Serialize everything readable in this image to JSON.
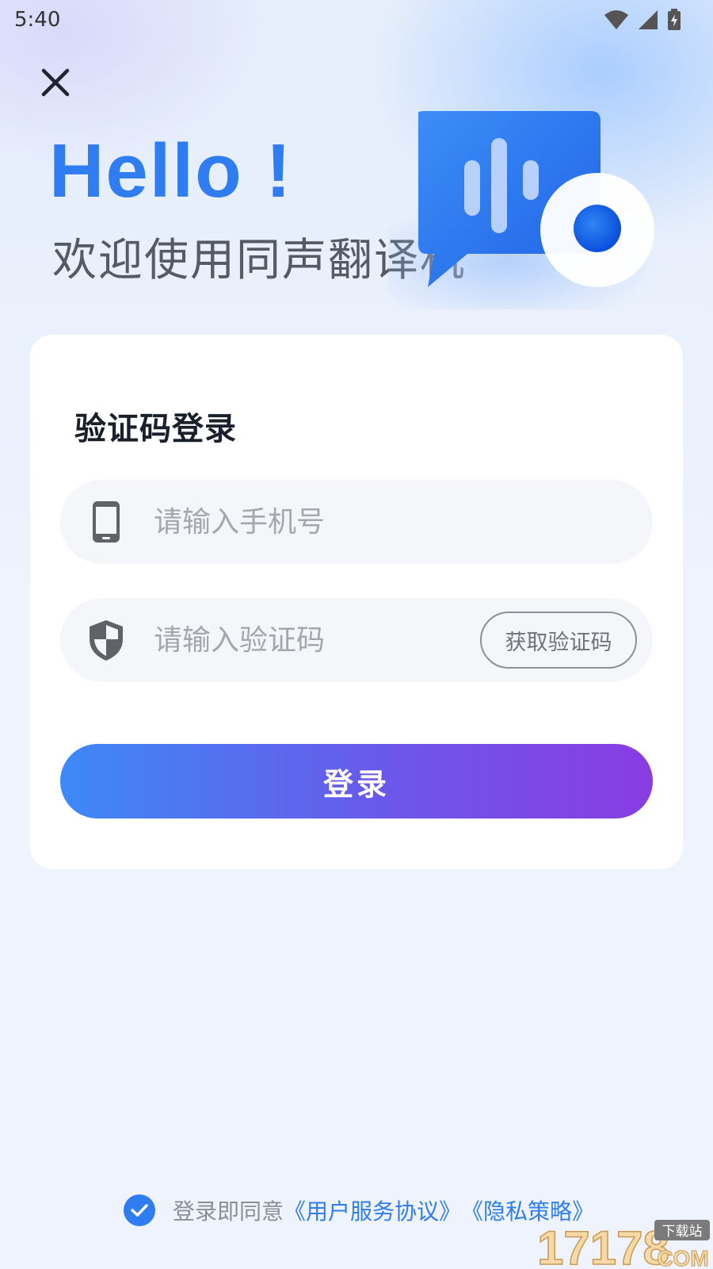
{
  "status_bar": {
    "time": "5:40"
  },
  "header": {
    "hello": "Hello !",
    "welcome": "欢迎使用同声翻译机"
  },
  "login_card": {
    "title": "验证码登录",
    "phone_placeholder": "请输入手机号",
    "code_placeholder": "请输入验证码",
    "get_code_label": "获取验证码",
    "login_label": "登录"
  },
  "agreement": {
    "checked": true,
    "prefix": "登录即同意",
    "user_agreement": "《用户服务协议》",
    "privacy_policy": "《隐私策略》"
  },
  "watermark": {
    "number": "17178",
    "sub": "下载站",
    "domain": "COM"
  },
  "colors": {
    "accent": "#2f7df0",
    "gradient_start": "#3d89f7",
    "gradient_end": "#8a3ce3"
  }
}
